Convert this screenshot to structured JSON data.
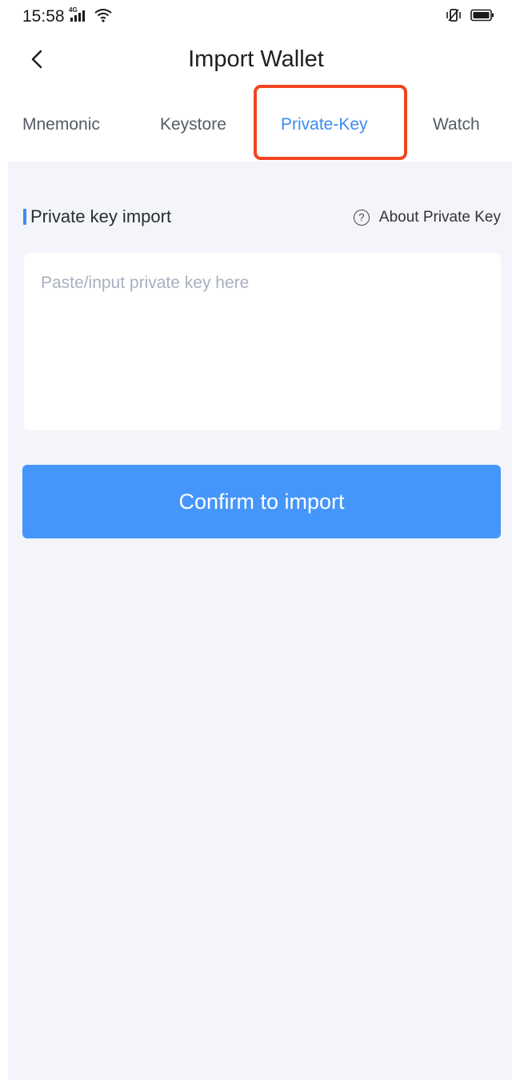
{
  "status_bar": {
    "time": "15:58",
    "network_type": "4G"
  },
  "header": {
    "title": "Import Wallet"
  },
  "tabs": [
    {
      "label": "Mnemonic",
      "active": false
    },
    {
      "label": "Keystore",
      "active": false
    },
    {
      "label": "Private-Key",
      "active": true
    },
    {
      "label": "Watch",
      "active": false
    }
  ],
  "section": {
    "title": "Private key import",
    "about_link": "About Private Key",
    "help_icon_glyph": "?"
  },
  "input": {
    "placeholder": "Paste/input private key here",
    "value": ""
  },
  "confirm_button": {
    "label": "Confirm to import"
  },
  "colors": {
    "accent": "#3d8bf2",
    "button": "#4596fb",
    "highlight_box": "#f0451f",
    "content_background": "#f3f5fa"
  }
}
